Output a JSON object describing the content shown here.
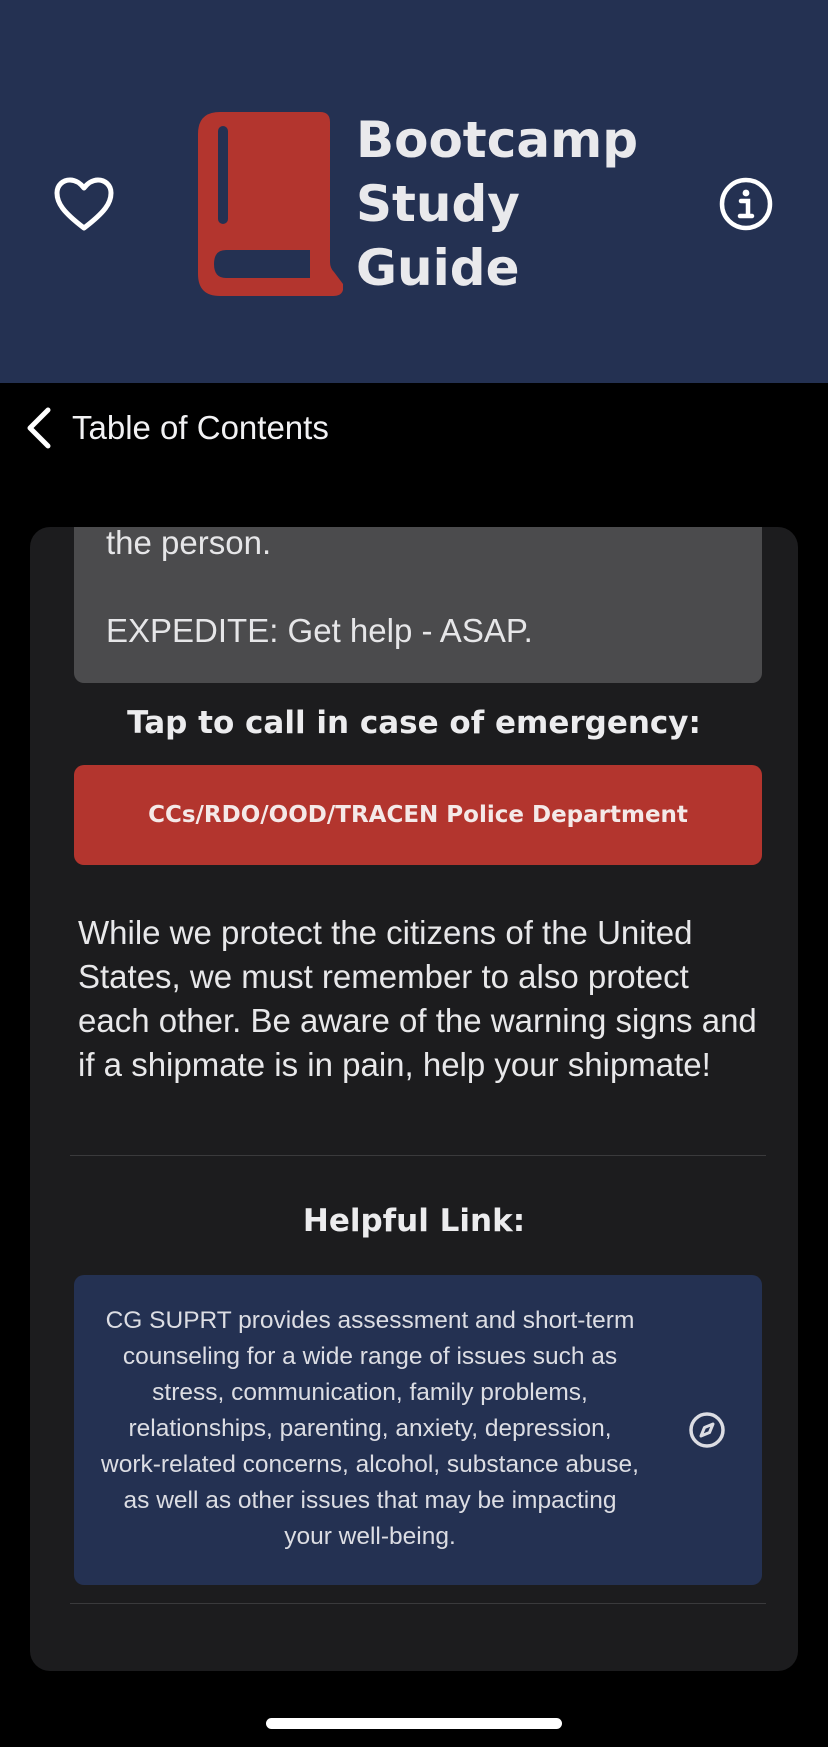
{
  "header": {
    "title": "Bootcamp\nStudy\nGuide",
    "logo_icon": "book-icon",
    "favorite_icon": "heart-icon",
    "info_icon": "info-icon",
    "background_color": "#243152",
    "logo_color": "#b3352e"
  },
  "nav": {
    "back_label": "Table of Contents",
    "back_icon": "chevron-left-icon"
  },
  "content": {
    "grey_box_line1": "the person.",
    "grey_box_line2": "EXPEDITE: Get help - ASAP.",
    "emergency_heading": "Tap to call in case of emergency:",
    "emergency_button_label": "CCs/RDO/OOD/TRACEN Police Department",
    "emergency_button_color": "#b3352e",
    "message": "While we protect the citizens of the United States, we must remember to also protect each other. Be aware of the warning signs and if a shipmate is in pain, help your shipmate!",
    "helpful_heading": "Helpful Link:",
    "link_text": "CG SUPRT provides assessment and short-term counseling for a wide range of issues such as stress, communication, family problems, relationships, parenting, anxiety, depression, work-related concerns, alcohol, substance abuse, as well as other issues that may be impacting your well-being.",
    "link_icon": "compass-icon"
  }
}
